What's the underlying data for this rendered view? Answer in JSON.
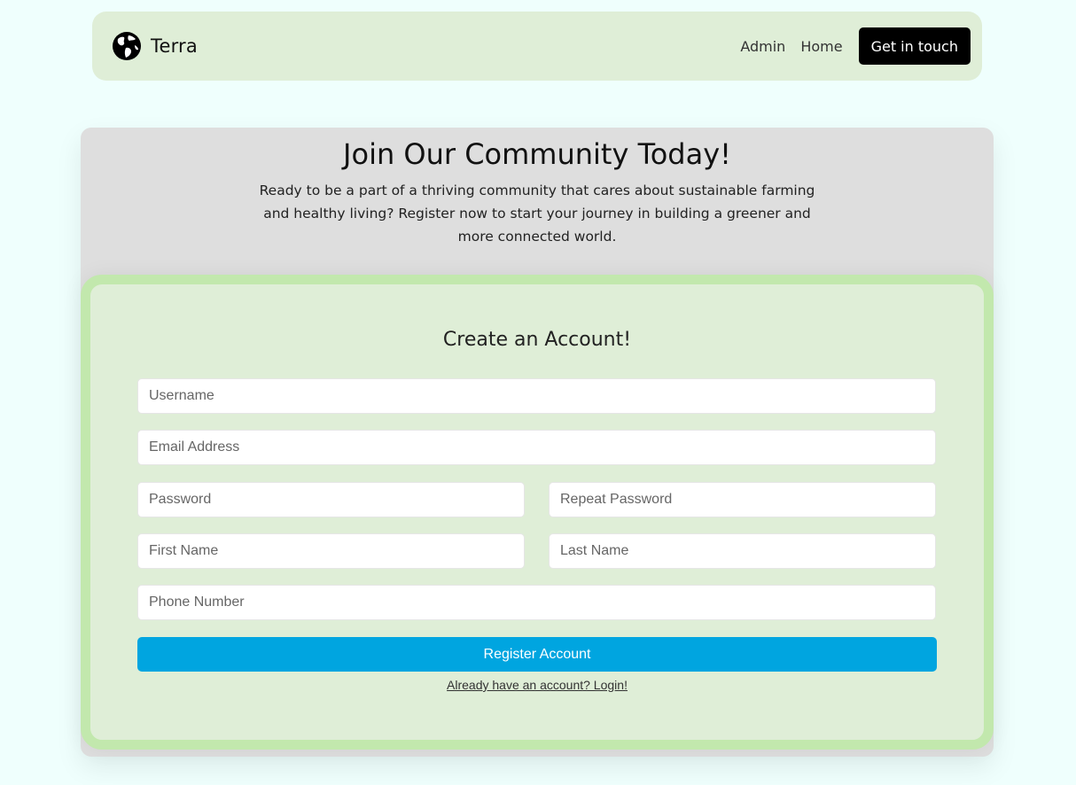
{
  "navbar": {
    "brand_name": "Terra",
    "brand_icon": "globe-icon",
    "links": [
      "Admin",
      "Home"
    ],
    "cta_label": "Get in touch"
  },
  "hero": {
    "title": "Join Our Community Today!",
    "description": "Ready to be a part of a thriving community that cares about sustainable farming and healthy living? Register now to start your journey in building a greener and more connected world."
  },
  "form": {
    "title": "Create an Account!",
    "fields": {
      "username": {
        "placeholder": "Username",
        "value": ""
      },
      "email": {
        "placeholder": "Email Address",
        "value": ""
      },
      "password": {
        "placeholder": "Password",
        "value": ""
      },
      "repeat_password": {
        "placeholder": "Repeat Password",
        "value": ""
      },
      "first_name": {
        "placeholder": "First Name",
        "value": ""
      },
      "last_name": {
        "placeholder": "Last Name",
        "value": ""
      },
      "phone": {
        "placeholder": "Phone Number",
        "value": ""
      }
    },
    "submit_label": "Register Account",
    "login_link": "Already have an account? Login!"
  },
  "colors": {
    "page_background": "#effffd",
    "navbar_background": "#dfeed7",
    "hero_background": "#dedede",
    "form_background": "#dfeed7",
    "form_border": "#c2e8ad",
    "cta_background": "#000000",
    "primary_button": "#00a5e0"
  }
}
